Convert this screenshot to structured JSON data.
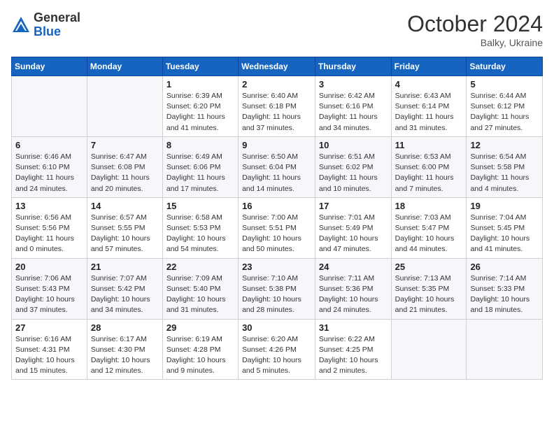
{
  "header": {
    "logo_general": "General",
    "logo_blue": "Blue",
    "month_year": "October 2024",
    "location": "Balky, Ukraine"
  },
  "days_of_week": [
    "Sunday",
    "Monday",
    "Tuesday",
    "Wednesday",
    "Thursday",
    "Friday",
    "Saturday"
  ],
  "weeks": [
    [
      {
        "day": "",
        "info": ""
      },
      {
        "day": "",
        "info": ""
      },
      {
        "day": "1",
        "info": "Sunrise: 6:39 AM\nSunset: 6:20 PM\nDaylight: 11 hours and 41 minutes."
      },
      {
        "day": "2",
        "info": "Sunrise: 6:40 AM\nSunset: 6:18 PM\nDaylight: 11 hours and 37 minutes."
      },
      {
        "day": "3",
        "info": "Sunrise: 6:42 AM\nSunset: 6:16 PM\nDaylight: 11 hours and 34 minutes."
      },
      {
        "day": "4",
        "info": "Sunrise: 6:43 AM\nSunset: 6:14 PM\nDaylight: 11 hours and 31 minutes."
      },
      {
        "day": "5",
        "info": "Sunrise: 6:44 AM\nSunset: 6:12 PM\nDaylight: 11 hours and 27 minutes."
      }
    ],
    [
      {
        "day": "6",
        "info": "Sunrise: 6:46 AM\nSunset: 6:10 PM\nDaylight: 11 hours and 24 minutes."
      },
      {
        "day": "7",
        "info": "Sunrise: 6:47 AM\nSunset: 6:08 PM\nDaylight: 11 hours and 20 minutes."
      },
      {
        "day": "8",
        "info": "Sunrise: 6:49 AM\nSunset: 6:06 PM\nDaylight: 11 hours and 17 minutes."
      },
      {
        "day": "9",
        "info": "Sunrise: 6:50 AM\nSunset: 6:04 PM\nDaylight: 11 hours and 14 minutes."
      },
      {
        "day": "10",
        "info": "Sunrise: 6:51 AM\nSunset: 6:02 PM\nDaylight: 11 hours and 10 minutes."
      },
      {
        "day": "11",
        "info": "Sunrise: 6:53 AM\nSunset: 6:00 PM\nDaylight: 11 hours and 7 minutes."
      },
      {
        "day": "12",
        "info": "Sunrise: 6:54 AM\nSunset: 5:58 PM\nDaylight: 11 hours and 4 minutes."
      }
    ],
    [
      {
        "day": "13",
        "info": "Sunrise: 6:56 AM\nSunset: 5:56 PM\nDaylight: 11 hours and 0 minutes."
      },
      {
        "day": "14",
        "info": "Sunrise: 6:57 AM\nSunset: 5:55 PM\nDaylight: 10 hours and 57 minutes."
      },
      {
        "day": "15",
        "info": "Sunrise: 6:58 AM\nSunset: 5:53 PM\nDaylight: 10 hours and 54 minutes."
      },
      {
        "day": "16",
        "info": "Sunrise: 7:00 AM\nSunset: 5:51 PM\nDaylight: 10 hours and 50 minutes."
      },
      {
        "day": "17",
        "info": "Sunrise: 7:01 AM\nSunset: 5:49 PM\nDaylight: 10 hours and 47 minutes."
      },
      {
        "day": "18",
        "info": "Sunrise: 7:03 AM\nSunset: 5:47 PM\nDaylight: 10 hours and 44 minutes."
      },
      {
        "day": "19",
        "info": "Sunrise: 7:04 AM\nSunset: 5:45 PM\nDaylight: 10 hours and 41 minutes."
      }
    ],
    [
      {
        "day": "20",
        "info": "Sunrise: 7:06 AM\nSunset: 5:43 PM\nDaylight: 10 hours and 37 minutes."
      },
      {
        "day": "21",
        "info": "Sunrise: 7:07 AM\nSunset: 5:42 PM\nDaylight: 10 hours and 34 minutes."
      },
      {
        "day": "22",
        "info": "Sunrise: 7:09 AM\nSunset: 5:40 PM\nDaylight: 10 hours and 31 minutes."
      },
      {
        "day": "23",
        "info": "Sunrise: 7:10 AM\nSunset: 5:38 PM\nDaylight: 10 hours and 28 minutes."
      },
      {
        "day": "24",
        "info": "Sunrise: 7:11 AM\nSunset: 5:36 PM\nDaylight: 10 hours and 24 minutes."
      },
      {
        "day": "25",
        "info": "Sunrise: 7:13 AM\nSunset: 5:35 PM\nDaylight: 10 hours and 21 minutes."
      },
      {
        "day": "26",
        "info": "Sunrise: 7:14 AM\nSunset: 5:33 PM\nDaylight: 10 hours and 18 minutes."
      }
    ],
    [
      {
        "day": "27",
        "info": "Sunrise: 6:16 AM\nSunset: 4:31 PM\nDaylight: 10 hours and 15 minutes."
      },
      {
        "day": "28",
        "info": "Sunrise: 6:17 AM\nSunset: 4:30 PM\nDaylight: 10 hours and 12 minutes."
      },
      {
        "day": "29",
        "info": "Sunrise: 6:19 AM\nSunset: 4:28 PM\nDaylight: 10 hours and 9 minutes."
      },
      {
        "day": "30",
        "info": "Sunrise: 6:20 AM\nSunset: 4:26 PM\nDaylight: 10 hours and 5 minutes."
      },
      {
        "day": "31",
        "info": "Sunrise: 6:22 AM\nSunset: 4:25 PM\nDaylight: 10 hours and 2 minutes."
      },
      {
        "day": "",
        "info": ""
      },
      {
        "day": "",
        "info": ""
      }
    ]
  ]
}
